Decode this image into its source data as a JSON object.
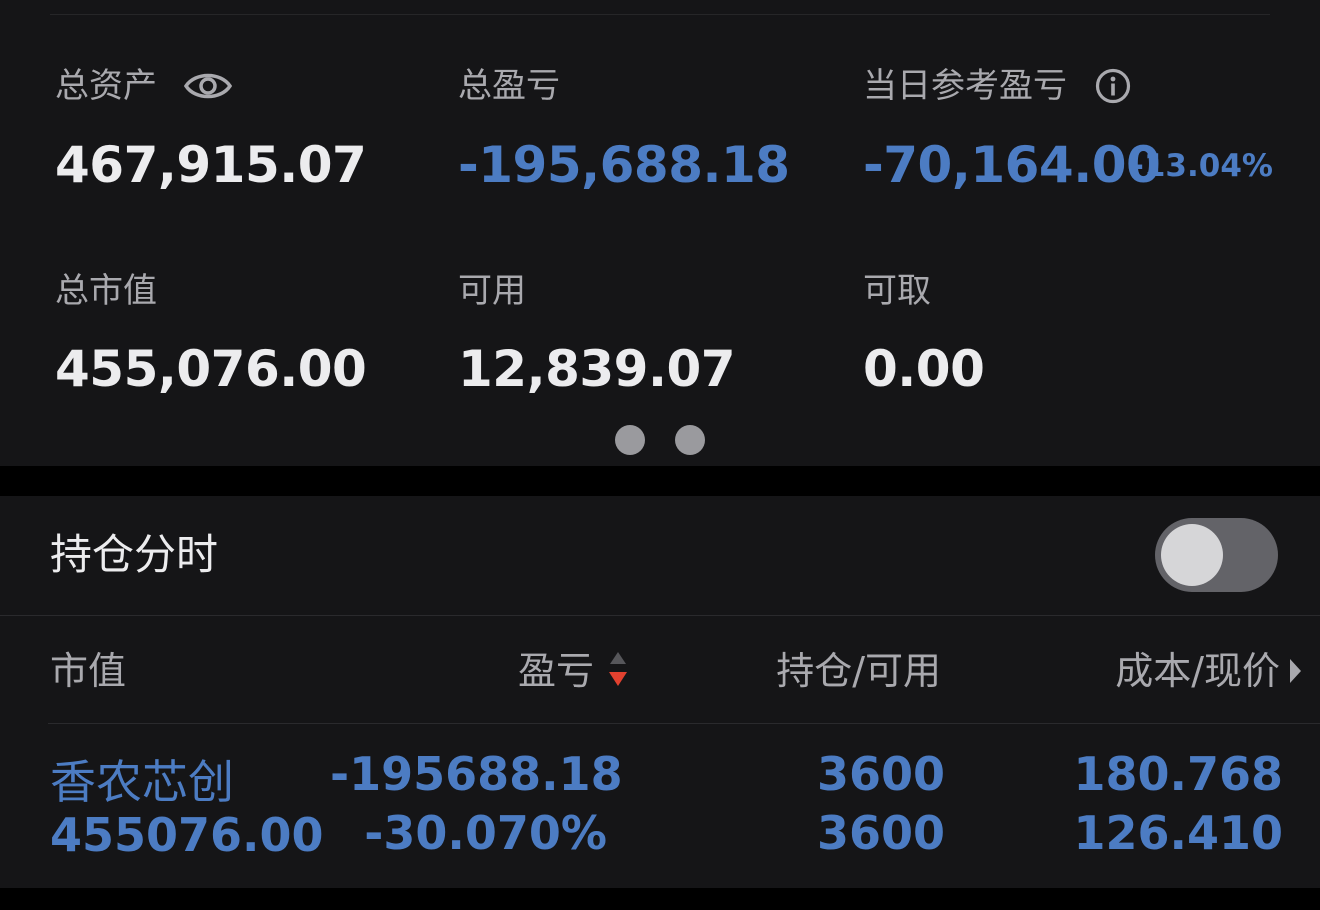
{
  "summary": {
    "total_assets_label": "总资产",
    "total_assets_value": "467,915.07",
    "total_pl_label": "总盈亏",
    "total_pl_value": "-195,688.18",
    "daily_pl_label": "当日参考盈亏",
    "daily_pl_value": "-70,164.00",
    "daily_pl_pct": "-13.04%",
    "market_value_label": "总市值",
    "market_value_value": "455,076.00",
    "available_label": "可用",
    "available_value": "12,839.07",
    "withdrawable_label": "可取",
    "withdrawable_value": "0.00",
    "pager_pages": 2
  },
  "positions": {
    "section_title": "持仓分时",
    "toggle_on": false,
    "columns": [
      "市值",
      "盈亏",
      "持仓/可用",
      "成本/现价"
    ],
    "rows": [
      {
        "name": "香农芯创",
        "market_value": "455076.00",
        "pl": "-195688.18",
        "pl_pct": "-30.070%",
        "holding": "3600",
        "available": "3600",
        "cost": "180.768",
        "price": "126.410"
      }
    ]
  },
  "colors": {
    "loss": "#4c7cc3",
    "sort_active": "#e2412f",
    "background": "#151517"
  },
  "icons": [
    "eye-icon",
    "info-icon",
    "sort-icon",
    "chevron-right-icon"
  ]
}
